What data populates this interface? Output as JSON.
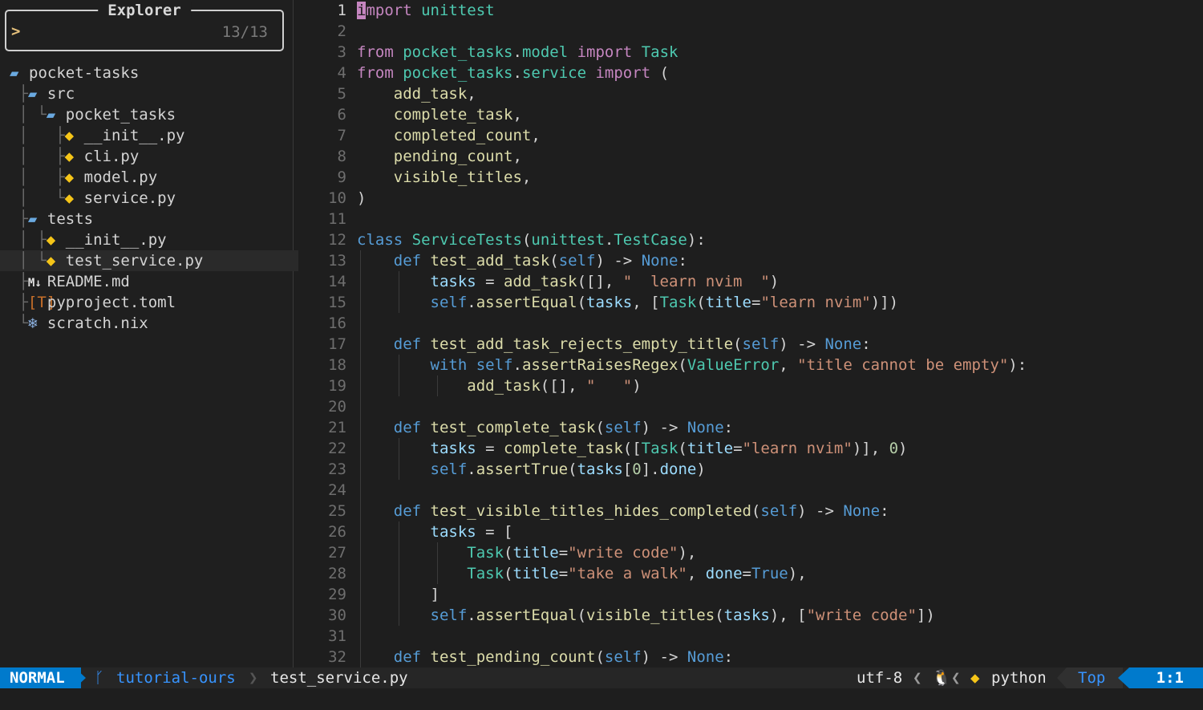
{
  "explorer": {
    "title": "Explorer",
    "prompt": ">",
    "count": "13/13",
    "tree": [
      {
        "guide": "",
        "icon": "folder",
        "name": "pocket-tasks"
      },
      {
        "guide": " ├",
        "icon": "folder",
        "name": "src"
      },
      {
        "guide": " │ └",
        "icon": "folder",
        "name": "pocket_tasks"
      },
      {
        "guide": " │   ├",
        "icon": "python",
        "name": "__init__.py"
      },
      {
        "guide": " │   ├",
        "icon": "python",
        "name": "cli.py"
      },
      {
        "guide": " │   ├",
        "icon": "python",
        "name": "model.py"
      },
      {
        "guide": " │   └",
        "icon": "python",
        "name": "service.py"
      },
      {
        "guide": " ├",
        "icon": "folder",
        "name": "tests"
      },
      {
        "guide": " │ ├",
        "icon": "python",
        "name": "__init__.py"
      },
      {
        "guide": " │ └",
        "icon": "python",
        "name": "test_service.py",
        "selected": true
      },
      {
        "guide": " ├",
        "icon": "markdown",
        "name": "README.md"
      },
      {
        "guide": " ├",
        "icon": "toml",
        "name": "pyproject.toml"
      },
      {
        "guide": " └",
        "icon": "nix",
        "name": "scratch.nix"
      }
    ]
  },
  "icons": {
    "folder": "▰",
    "python": "◆",
    "markdown": "M↓",
    "toml": "[T]",
    "nix": "❄"
  },
  "editor": {
    "current_line": 1,
    "lines": [
      [
        [
          "cursor",
          "i"
        ],
        [
          "kw",
          "mport"
        ],
        [
          "plain",
          " "
        ],
        [
          "mod",
          "unittest"
        ]
      ],
      [],
      [
        [
          "kw",
          "from"
        ],
        [
          "plain",
          " "
        ],
        [
          "mod",
          "pocket_tasks"
        ],
        [
          "plain",
          "."
        ],
        [
          "mod",
          "model"
        ],
        [
          "plain",
          " "
        ],
        [
          "kw",
          "import"
        ],
        [
          "plain",
          " "
        ],
        [
          "cls",
          "Task"
        ]
      ],
      [
        [
          "kw",
          "from"
        ],
        [
          "plain",
          " "
        ],
        [
          "mod",
          "pocket_tasks"
        ],
        [
          "plain",
          "."
        ],
        [
          "mod",
          "service"
        ],
        [
          "plain",
          " "
        ],
        [
          "kw",
          "import"
        ],
        [
          "plain",
          " ("
        ]
      ],
      [
        [
          "plain",
          "    "
        ],
        [
          "fn",
          "add_task"
        ],
        [
          "plain",
          ","
        ]
      ],
      [
        [
          "plain",
          "    "
        ],
        [
          "fn",
          "complete_task"
        ],
        [
          "plain",
          ","
        ]
      ],
      [
        [
          "plain",
          "    "
        ],
        [
          "fn",
          "completed_count"
        ],
        [
          "plain",
          ","
        ]
      ],
      [
        [
          "plain",
          "    "
        ],
        [
          "fn",
          "pending_count"
        ],
        [
          "plain",
          ","
        ]
      ],
      [
        [
          "plain",
          "    "
        ],
        [
          "fn",
          "visible_titles"
        ],
        [
          "plain",
          ","
        ]
      ],
      [
        [
          "plain",
          ")"
        ]
      ],
      [],
      [
        [
          "kw2",
          "class"
        ],
        [
          "plain",
          " "
        ],
        [
          "cls",
          "ServiceTests"
        ],
        [
          "plain",
          "("
        ],
        [
          "mod",
          "unittest"
        ],
        [
          "plain",
          "."
        ],
        [
          "cls",
          "TestCase"
        ],
        [
          "plain",
          "):"
        ]
      ],
      [
        [
          "plain",
          "    "
        ],
        [
          "kw2",
          "def"
        ],
        [
          "plain",
          " "
        ],
        [
          "fn",
          "test_add_task"
        ],
        [
          "plain",
          "("
        ],
        [
          "slf",
          "self"
        ],
        [
          "plain",
          ") -> "
        ],
        [
          "kw2",
          "None"
        ],
        [
          "plain",
          ":"
        ]
      ],
      [
        [
          "plain",
          "        "
        ],
        [
          "var",
          "tasks"
        ],
        [
          "plain",
          " = "
        ],
        [
          "fn",
          "add_task"
        ],
        [
          "plain",
          "([], "
        ],
        [
          "str",
          "\"  learn nvim  \""
        ],
        [
          "plain",
          ")"
        ]
      ],
      [
        [
          "plain",
          "        "
        ],
        [
          "slf",
          "self"
        ],
        [
          "plain",
          "."
        ],
        [
          "fn",
          "assertEqual"
        ],
        [
          "plain",
          "("
        ],
        [
          "var",
          "tasks"
        ],
        [
          "plain",
          ", ["
        ],
        [
          "cls",
          "Task"
        ],
        [
          "plain",
          "("
        ],
        [
          "var",
          "title"
        ],
        [
          "plain",
          "="
        ],
        [
          "str",
          "\"learn nvim\""
        ],
        [
          "plain",
          ")])"
        ]
      ],
      [],
      [
        [
          "plain",
          "    "
        ],
        [
          "kw2",
          "def"
        ],
        [
          "plain",
          " "
        ],
        [
          "fn",
          "test_add_task_rejects_empty_title"
        ],
        [
          "plain",
          "("
        ],
        [
          "slf",
          "self"
        ],
        [
          "plain",
          ") -> "
        ],
        [
          "kw2",
          "None"
        ],
        [
          "plain",
          ":"
        ]
      ],
      [
        [
          "plain",
          "        "
        ],
        [
          "kw2",
          "with"
        ],
        [
          "plain",
          " "
        ],
        [
          "slf",
          "self"
        ],
        [
          "plain",
          "."
        ],
        [
          "fn",
          "assertRaisesRegex"
        ],
        [
          "plain",
          "("
        ],
        [
          "cls",
          "ValueError"
        ],
        [
          "plain",
          ", "
        ],
        [
          "str",
          "\"title cannot be empty\""
        ],
        [
          "plain",
          "):"
        ]
      ],
      [
        [
          "plain",
          "            "
        ],
        [
          "fn",
          "add_task"
        ],
        [
          "plain",
          "([], "
        ],
        [
          "str",
          "\"   \""
        ],
        [
          "plain",
          ")"
        ]
      ],
      [],
      [
        [
          "plain",
          "    "
        ],
        [
          "kw2",
          "def"
        ],
        [
          "plain",
          " "
        ],
        [
          "fn",
          "test_complete_task"
        ],
        [
          "plain",
          "("
        ],
        [
          "slf",
          "self"
        ],
        [
          "plain",
          ") -> "
        ],
        [
          "kw2",
          "None"
        ],
        [
          "plain",
          ":"
        ]
      ],
      [
        [
          "plain",
          "        "
        ],
        [
          "var",
          "tasks"
        ],
        [
          "plain",
          " = "
        ],
        [
          "fn",
          "complete_task"
        ],
        [
          "plain",
          "(["
        ],
        [
          "cls",
          "Task"
        ],
        [
          "plain",
          "("
        ],
        [
          "var",
          "title"
        ],
        [
          "plain",
          "="
        ],
        [
          "str",
          "\"learn nvim\""
        ],
        [
          "plain",
          ")], "
        ],
        [
          "num",
          "0"
        ],
        [
          "plain",
          ")"
        ]
      ],
      [
        [
          "plain",
          "        "
        ],
        [
          "slf",
          "self"
        ],
        [
          "plain",
          "."
        ],
        [
          "fn",
          "assertTrue"
        ],
        [
          "plain",
          "("
        ],
        [
          "var",
          "tasks"
        ],
        [
          "plain",
          "["
        ],
        [
          "num",
          "0"
        ],
        [
          "plain",
          "]."
        ],
        [
          "var",
          "done"
        ],
        [
          "plain",
          ")"
        ]
      ],
      [],
      [
        [
          "plain",
          "    "
        ],
        [
          "kw2",
          "def"
        ],
        [
          "plain",
          " "
        ],
        [
          "fn",
          "test_visible_titles_hides_completed"
        ],
        [
          "plain",
          "("
        ],
        [
          "slf",
          "self"
        ],
        [
          "plain",
          ") -> "
        ],
        [
          "kw2",
          "None"
        ],
        [
          "plain",
          ":"
        ]
      ],
      [
        [
          "plain",
          "        "
        ],
        [
          "var",
          "tasks"
        ],
        [
          "plain",
          " = ["
        ]
      ],
      [
        [
          "plain",
          "            "
        ],
        [
          "cls",
          "Task"
        ],
        [
          "plain",
          "("
        ],
        [
          "var",
          "title"
        ],
        [
          "plain",
          "="
        ],
        [
          "str",
          "\"write code\""
        ],
        [
          "plain",
          "),"
        ]
      ],
      [
        [
          "plain",
          "            "
        ],
        [
          "cls",
          "Task"
        ],
        [
          "plain",
          "("
        ],
        [
          "var",
          "title"
        ],
        [
          "plain",
          "="
        ],
        [
          "str",
          "\"take a walk\""
        ],
        [
          "plain",
          ", "
        ],
        [
          "var",
          "done"
        ],
        [
          "plain",
          "="
        ],
        [
          "kw2",
          "True"
        ],
        [
          "plain",
          "),"
        ]
      ],
      [
        [
          "plain",
          "        ]"
        ]
      ],
      [
        [
          "plain",
          "        "
        ],
        [
          "slf",
          "self"
        ],
        [
          "plain",
          "."
        ],
        [
          "fn",
          "assertEqual"
        ],
        [
          "plain",
          "("
        ],
        [
          "fn",
          "visible_titles"
        ],
        [
          "plain",
          "("
        ],
        [
          "var",
          "tasks"
        ],
        [
          "plain",
          "), ["
        ],
        [
          "str",
          "\"write code\""
        ],
        [
          "plain",
          "])"
        ]
      ],
      [],
      [
        [
          "plain",
          "    "
        ],
        [
          "kw2",
          "def"
        ],
        [
          "plain",
          " "
        ],
        [
          "fn",
          "test_pending_count"
        ],
        [
          "plain",
          "("
        ],
        [
          "slf",
          "self"
        ],
        [
          "plain",
          ") -> "
        ],
        [
          "kw2",
          "None"
        ],
        [
          "plain",
          ":"
        ]
      ]
    ]
  },
  "status": {
    "mode": "NORMAL",
    "branch_icon": "ᚴ",
    "branch": "tutorial-ours",
    "branch_sep": "❯",
    "filename": "test_service.py",
    "encoding": "utf-8",
    "sep": "❮",
    "os_icon": "🐧",
    "filetype_icon": "◆",
    "filetype": "python",
    "scroll": "Top",
    "position": "1:1"
  }
}
